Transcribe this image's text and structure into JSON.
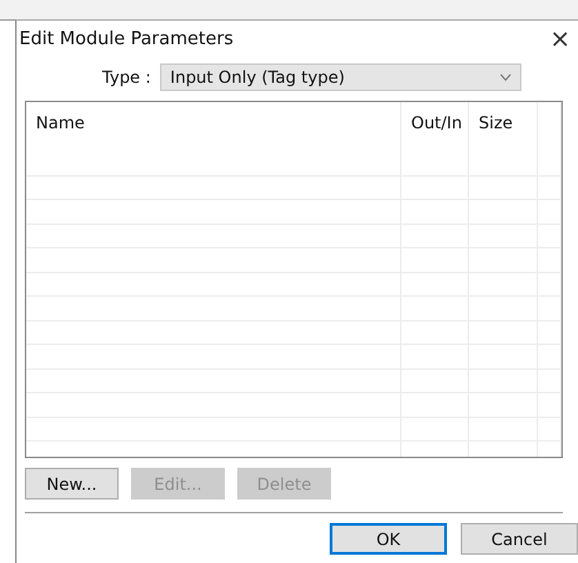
{
  "window": {
    "title": "Edit Module Parameters",
    "close": "×"
  },
  "type_field": {
    "label": "Type :",
    "value": "Input Only (Tag type)"
  },
  "table": {
    "columns": [
      "Name",
      "Out/In",
      "Size"
    ]
  },
  "buttons": [
    {
      "label": "New...",
      "disabled": false
    },
    {
      "label": "Edit...",
      "disabled": true
    },
    {
      "label": "Delete",
      "disabled": true
    }
  ],
  "dialog_buttons": [
    {
      "label": "OK",
      "default": true
    },
    {
      "label": "Cancel",
      "default": false
    }
  ]
}
